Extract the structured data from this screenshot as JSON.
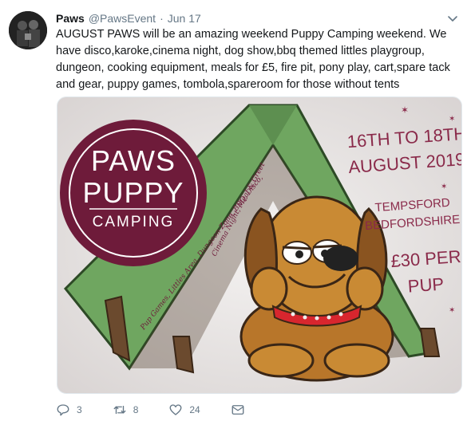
{
  "tweet": {
    "author_name": "Paws",
    "author_handle": "@PawsEvent",
    "separator": "·",
    "date": "Jun 17",
    "text": "AUGUST PAWS will be an amazing weekend Puppy Camping weekend. We have disco,karoke,cinema night, dog show,bbq themed littles playgroup, dungeon, cooking equipment, meals for £5, fire pit, pony play, cart,spare tack and gear, puppy games, tombola,spareroom for those without tents"
  },
  "poster": {
    "logo_line1": "PAWS",
    "logo_line2": "PUPPY",
    "logo_line3": "CAMPING",
    "date_line1": "16TH TO 18TH",
    "date_line2": "AUGUST 2019",
    "venue_line1": "TEMPSFORD",
    "venue_line2": "BEDFORDSHIRE",
    "price_line1": "£30 PER",
    "price_line2": "PUP",
    "tent_left_text": "Pup Games, Littles Area, Dungeon Zone, BBQ, Disco,",
    "tent_right_text": "Cinema Night, Meal & Greet",
    "colors": {
      "logo_circle": "#6e1b3a",
      "tent": "#6fa660",
      "text_accent": "#8a2a4a"
    }
  },
  "actions": {
    "reply_count": "3",
    "retweet_count": "8",
    "like_count": "24"
  },
  "icons": [
    "reply-icon",
    "retweet-icon",
    "like-icon",
    "message-icon",
    "chevron-down-icon"
  ]
}
